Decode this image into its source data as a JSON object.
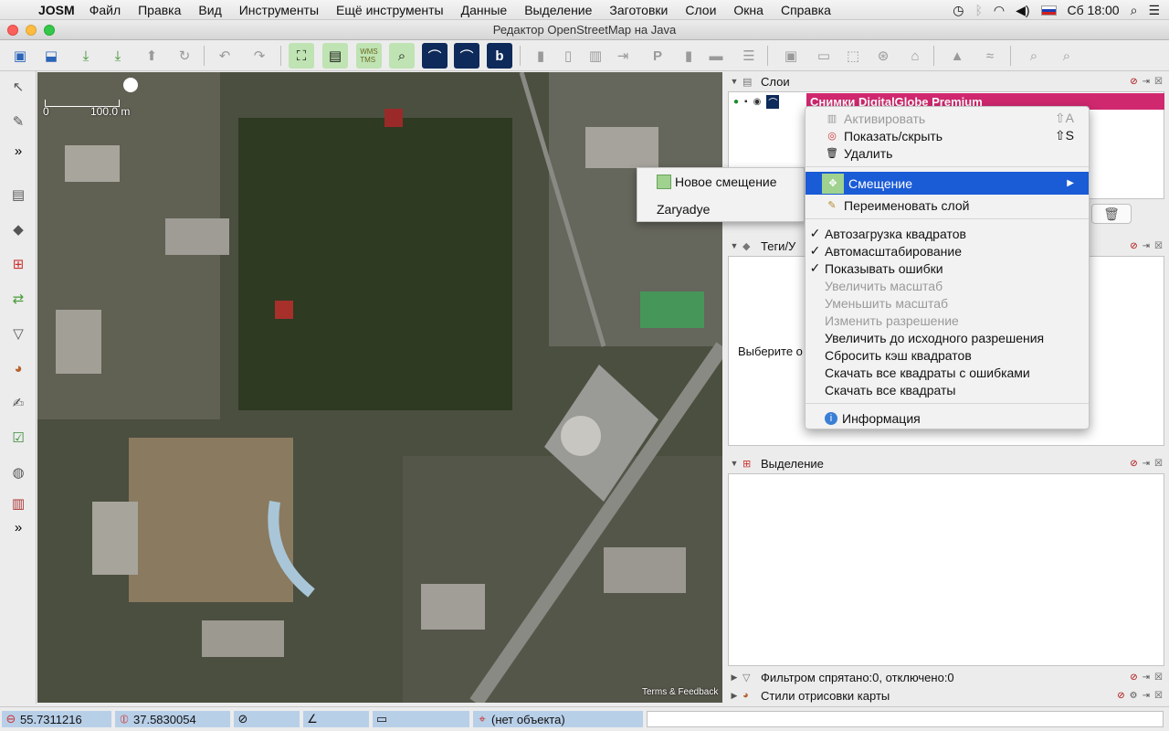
{
  "menubar": {
    "app_name": "JOSM",
    "items": [
      "Файл",
      "Правка",
      "Вид",
      "Инструменты",
      "Ещё инструменты",
      "Данные",
      "Выделение",
      "Заготовки",
      "Слои",
      "Окна",
      "Справка"
    ],
    "clock": "Сб 18:00"
  },
  "window": {
    "title": "Редактор OpenStreetMap на Java"
  },
  "toolbar": {
    "wms_label": "WMS\nTMS"
  },
  "map": {
    "scale_left": "0",
    "scale_right": "100.0 m",
    "terms": "Terms & Feedback"
  },
  "layers_panel": {
    "title": "Слои",
    "layer_name": "Снимки DigitalGlobe Premium"
  },
  "tags_panel": {
    "title": "Теги/У",
    "hint": "Выберите о"
  },
  "selection_panel": {
    "title": "Выделение"
  },
  "filter_panel": {
    "title": "Фильтром спрятано:0, отключено:0"
  },
  "styles_panel": {
    "title": "Стили отрисовки карты"
  },
  "context_menu": {
    "activate": {
      "label": "Активировать",
      "shortcut": "⇧A"
    },
    "toggle_visibility": {
      "label": "Показать/скрыть",
      "shortcut": "⇧S"
    },
    "delete": {
      "label": "Удалить"
    },
    "offset": {
      "label": "Смещение"
    },
    "rename": {
      "label": "Переименовать слой"
    },
    "autoload": {
      "label": "Автозагрузка квадратов"
    },
    "autozoom": {
      "label": "Автомасштабирование"
    },
    "show_errors": {
      "label": "Показывать ошибки"
    },
    "zoom_in": {
      "label": "Увеличить масштаб"
    },
    "zoom_out": {
      "label": "Уменьшить масштаб"
    },
    "change_resolution": {
      "label": "Изменить разрешение"
    },
    "zoom_native": {
      "label": "Увеличить до исходного разрешения"
    },
    "flush_cache": {
      "label": "Сбросить кэш квадратов"
    },
    "download_errors": {
      "label": "Скачать все квадраты с ошибками"
    },
    "download_all": {
      "label": "Скачать все квадраты"
    },
    "info": {
      "label": "Информация"
    }
  },
  "offset_submenu": {
    "new_offset": "Новое смещение",
    "zaryadye": "Zaryadye"
  },
  "statusbar": {
    "lat": "55.7311216",
    "lon": "37.5830054",
    "object": "(нет объекта)"
  },
  "colors": {
    "selected_layer": "#d0286f",
    "menu_highlight": "#1a5bd6",
    "status_field": "#b8cfe8"
  }
}
